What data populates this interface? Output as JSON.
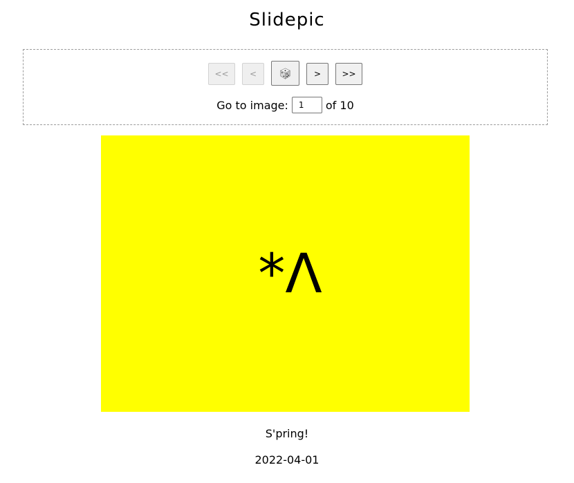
{
  "site": {
    "title": "Slidepic"
  },
  "nav": {
    "first_label": "<<",
    "prev_label": "<",
    "random_icon": "dice-icon",
    "next_label": ">",
    "last_label": ">>",
    "first_disabled": true,
    "prev_disabled": true
  },
  "goto": {
    "label": "Go to image:",
    "value": "1",
    "total_text": "of 10"
  },
  "slide": {
    "background_color": "#ffff00",
    "art_text": "*Λ",
    "caption": "S'pring!",
    "date": "2022-04-01"
  }
}
